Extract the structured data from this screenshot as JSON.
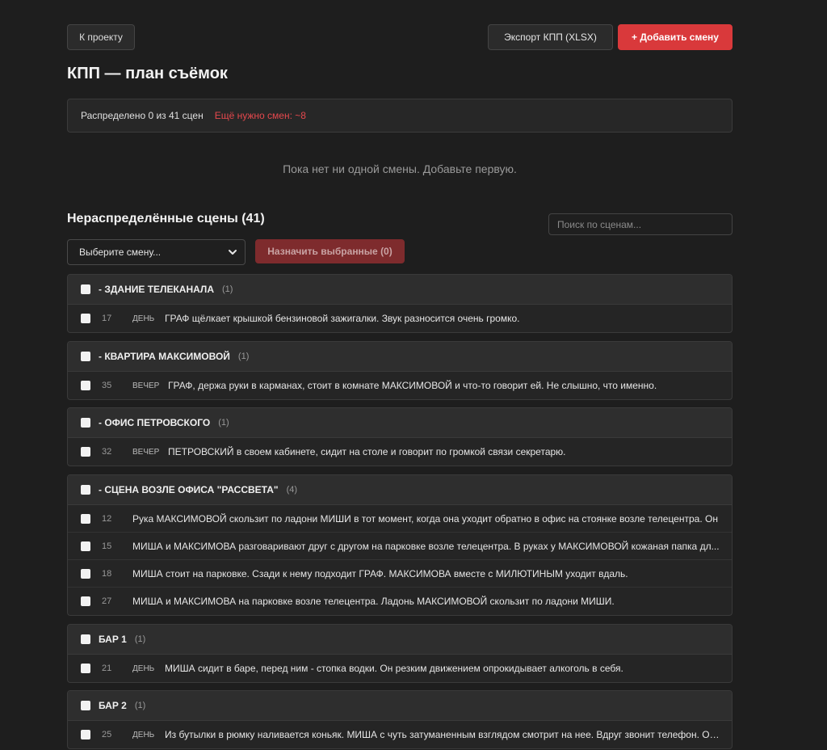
{
  "toolbar": {
    "back_label": "К проекту",
    "export_label": "Экспорт КПП (XLSX)",
    "add_label": "+ Добавить смену"
  },
  "page_title": "КПП — план съёмок",
  "status": {
    "distributed": "Распределено 0 из 41 сцен",
    "need_more": "Ещё нужно смен: ~8"
  },
  "empty_text": "Пока нет ни одной смены. Добавьте первую.",
  "unassigned": {
    "title": "Нераспределённые сцены (41)",
    "search_placeholder": "Поиск по сценам...",
    "select_value": "Выберите смену...",
    "assign_label": "Назначить выбранные (0)"
  },
  "groups": [
    {
      "name": "- ЗДАНИЕ ТЕЛЕКАНАЛА",
      "count": "(1)",
      "scenes": [
        {
          "num": "17",
          "tod": "ДЕНЬ",
          "desc": "ГРАФ щёлкает крышкой бензиновой зажигалки. Звук разносится очень громко."
        }
      ]
    },
    {
      "name": "- КВАРТИРА МАКСИМОВОЙ",
      "count": "(1)",
      "scenes": [
        {
          "num": "35",
          "tod": "ВЕЧЕР",
          "desc": "ГРАФ, держа руки в карманах, стоит в комнате МАКСИМОВОЙ и что-то говорит ей. Не слышно, что именно."
        }
      ]
    },
    {
      "name": "- ОФИС ПЕТРОВСКОГО",
      "count": "(1)",
      "scenes": [
        {
          "num": "32",
          "tod": "ВЕЧЕР",
          "desc": "ПЕТРОВСКИЙ в своем кабинете, сидит на столе и говорит по громкой связи секретарю."
        }
      ]
    },
    {
      "name": "- СЦЕНА ВОЗЛЕ ОФИСА \"РАССВЕТА\"",
      "count": "(4)",
      "scenes": [
        {
          "num": "12",
          "tod": "",
          "desc": "Рука МАКСИМОВОЙ скользит по ладони МИШИ в тот момент, когда она уходит обратно в офис на стоянке возле телецентра. Он"
        },
        {
          "num": "15",
          "tod": "",
          "desc": "МИША и МАКСИМОВА разговаривают друг с другом на парковке возле телецентра. В руках у МАКСИМОВОЙ кожаная папка дл..."
        },
        {
          "num": "18",
          "tod": "",
          "desc": "МИША стоит на парковке. Сзади к нему подходит ГРАФ. МАКСИМОВА вместе с МИЛЮТИНЫМ уходит вдаль."
        },
        {
          "num": "27",
          "tod": "",
          "desc": "МИША и МАКСИМОВА на парковке возле телецентра. Ладонь МАКСИМОВОЙ скользит по ладони МИШИ."
        }
      ]
    },
    {
      "name": "БАР 1",
      "count": "(1)",
      "scenes": [
        {
          "num": "21",
          "tod": "ДЕНЬ",
          "desc": "МИША сидит в баре, перед ним - стопка водки. Он резким движением опрокидывает алкоголь в себя."
        }
      ]
    },
    {
      "name": "БАР 2",
      "count": "(1)",
      "scenes": [
        {
          "num": "25",
          "tod": "ДЕНЬ",
          "desc": "Из бутылки в рюмку наливается коньяк. МИША с чуть затуманенным взглядом смотрит на нее. Вдруг звонит телефон. Он..."
        }
      ]
    }
  ]
}
